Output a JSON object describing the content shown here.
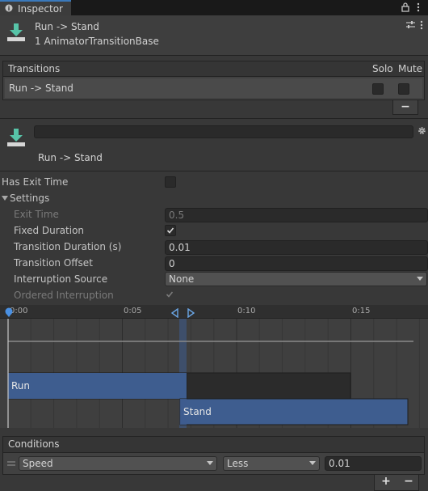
{
  "tab": {
    "label": "Inspector",
    "lock_icon": "lock-icon",
    "menu_icon": "kebab-menu-icon"
  },
  "header": {
    "title": "Run -> Stand",
    "subtitle": "1 AnimatorTransitionBase",
    "icon": "transition-icon"
  },
  "transitions": {
    "header_label": "Transitions",
    "solo_label": "Solo",
    "mute_label": "Mute",
    "rows": [
      {
        "label": "Run -> Stand",
        "solo": false,
        "mute": false
      }
    ],
    "remove_label": "−"
  },
  "transition": {
    "name_value": "",
    "name": "Run -> Stand",
    "gear_icon": "gear-icon"
  },
  "settings": {
    "has_exit_time_label": "Has Exit Time",
    "has_exit_time": false,
    "settings_label": "Settings",
    "exit_time_label": "Exit Time",
    "exit_time_value": "0.5",
    "fixed_duration_label": "Fixed Duration",
    "fixed_duration": true,
    "transition_duration_label": "Transition Duration (s)",
    "transition_duration_value": "0.01",
    "transition_offset_label": "Transition Offset",
    "transition_offset_value": "0",
    "interruption_source_label": "Interruption Source",
    "interruption_source_value": "None",
    "ordered_interruption_label": "Ordered Interruption",
    "ordered_interruption": true
  },
  "timeline": {
    "ticks": [
      {
        "label": "0:00",
        "frame": 0
      },
      {
        "label": "0:05",
        "frame": 5
      },
      {
        "label": "0:10",
        "frame": 10
      },
      {
        "label": "0:15",
        "frame": 15
      }
    ],
    "clips": [
      {
        "label": "Run"
      },
      {
        "label": "Stand"
      }
    ]
  },
  "conditions": {
    "header_label": "Conditions",
    "rows": [
      {
        "parameter": "Speed",
        "operator": "Less",
        "value": "0.01"
      }
    ],
    "add_label": "+",
    "remove_label": "−"
  },
  "colors": {
    "accent": "#3a79bb",
    "clip_blue": "#3e5d8f",
    "panel": "#383838"
  }
}
